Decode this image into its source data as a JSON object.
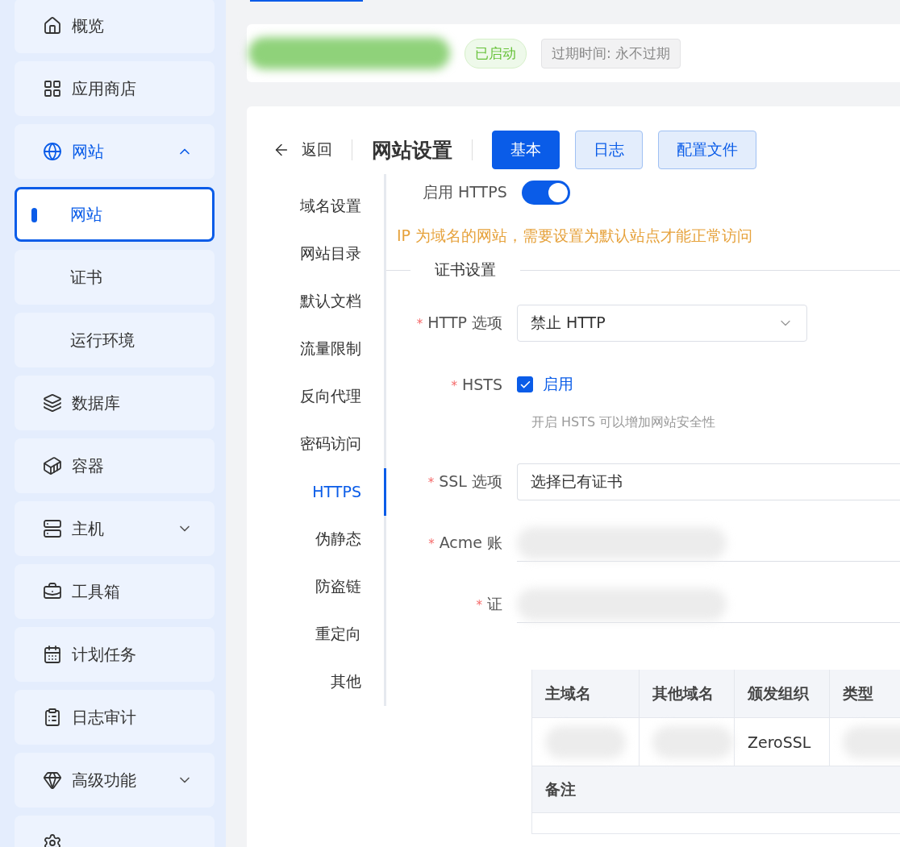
{
  "sidebar": {
    "items": [
      {
        "label": "概览",
        "kind": "item",
        "selected": false
      },
      {
        "label": "应用商店",
        "kind": "item",
        "selected": false
      },
      {
        "label": "网站",
        "kind": "group",
        "selected": false,
        "expanded": true,
        "children": [
          {
            "label": "网站",
            "selected": true
          },
          {
            "label": "证书",
            "selected": false
          },
          {
            "label": "运行环境",
            "selected": false
          }
        ]
      },
      {
        "label": "数据库",
        "kind": "item",
        "selected": false
      },
      {
        "label": "容器",
        "kind": "item",
        "selected": false
      },
      {
        "label": "主机",
        "kind": "group",
        "selected": false,
        "expanded": false
      },
      {
        "label": "工具箱",
        "kind": "item",
        "selected": false
      },
      {
        "label": "计划任务",
        "kind": "item",
        "selected": false
      },
      {
        "label": "日志审计",
        "kind": "item",
        "selected": false
      },
      {
        "label": "高级功能",
        "kind": "group",
        "selected": false,
        "expanded": false
      },
      {
        "kind": "cut",
        "selected": false
      }
    ]
  },
  "site_card": {
    "status": "已启动",
    "expiry": "过期时间: 永不过期"
  },
  "header": {
    "back": "返回",
    "title": "网站设置",
    "tabs": [
      {
        "label": "基本",
        "selected": true
      },
      {
        "label": "日志",
        "selected": false
      },
      {
        "label": "配置文件",
        "selected": false
      }
    ]
  },
  "settings_nav": [
    {
      "label": "域名设置",
      "selected": false
    },
    {
      "label": "网站目录",
      "selected": false
    },
    {
      "label": "默认文档",
      "selected": false
    },
    {
      "label": "流量限制",
      "selected": false
    },
    {
      "label": "反向代理",
      "selected": false
    },
    {
      "label": "密码访问",
      "selected": false
    },
    {
      "label": "HTTPS",
      "selected": true
    },
    {
      "label": "伪静态",
      "selected": false
    },
    {
      "label": "防盗链",
      "selected": false
    },
    {
      "label": "重定向",
      "selected": false
    },
    {
      "label": "其他",
      "selected": false
    }
  ],
  "https": {
    "label": "启用 HTTPS",
    "on": true,
    "warning": "IP 为域名的网站，需要设置为默认站点才能正常访问",
    "section": "证书设置",
    "fields": [
      {
        "kind": "select",
        "required_mark": "*",
        "label": "HTTP 选项",
        "value": "禁止 HTTP"
      },
      {
        "kind": "checkbox",
        "required_mark": "*",
        "label": "HSTS",
        "option": "启用",
        "checked": true,
        "help": "开启 HSTS 可以增加网站安全性"
      },
      {
        "kind": "input",
        "required_mark": "*",
        "label": "SSL 选项",
        "value": "选择已有证书"
      },
      {
        "kind": "redacted",
        "required_mark": "*",
        "label": "Acme 账"
      },
      {
        "kind": "redacted",
        "required_mark": "*",
        "label": "证"
      }
    ],
    "table": {
      "columns": [
        "主域名",
        "其他域名",
        "颁发组织",
        "类型"
      ],
      "row": [
        {
          "kind": "redacted"
        },
        {
          "kind": "redacted"
        },
        {
          "kind": "text",
          "text": "ZeroSSL"
        },
        {
          "kind": "redacted"
        }
      ],
      "note_label": "备注"
    }
  }
}
